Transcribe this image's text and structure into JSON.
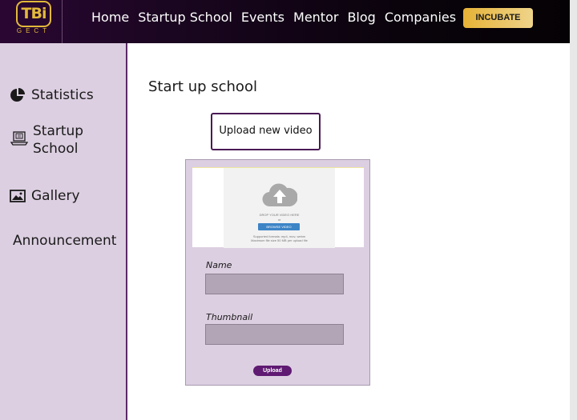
{
  "logo": {
    "text": "TBi",
    "subtext": "GECT"
  },
  "nav": {
    "items": [
      "Home",
      "Startup School",
      "Events",
      "Mentor",
      "Blog",
      "Companies"
    ],
    "cta_label": "INCUBATE"
  },
  "sidebar": {
    "items": [
      {
        "label": "Statistics",
        "icon": "pie-chart-icon"
      },
      {
        "label": "Startup\nSchool",
        "icon": "laptop-icon"
      },
      {
        "label": "Gallery",
        "icon": "image-icon"
      },
      {
        "label": "Announcement",
        "icon": ""
      }
    ]
  },
  "main": {
    "title": "Start up school",
    "upload_label": "Upload new video",
    "form": {
      "dropzone": {
        "drop_text": "DROP YOUR VIDEO HERE",
        "or_text": "or",
        "browse_label": "BROWSE VIDEO",
        "hint_line1": "Supported formats: mp4, mov, webm",
        "hint_line2": "Maximum file size 50 MB per upload file"
      },
      "name_label": "Name",
      "name_value": "",
      "thumbnail_label": "Thumbnail",
      "thumbnail_value": "",
      "submit_label": "Upload"
    }
  },
  "colors": {
    "topbar": "#1a0620",
    "accent": "#e2b93b",
    "sidebar": "#dccfe1",
    "submit": "#5f1a72"
  }
}
